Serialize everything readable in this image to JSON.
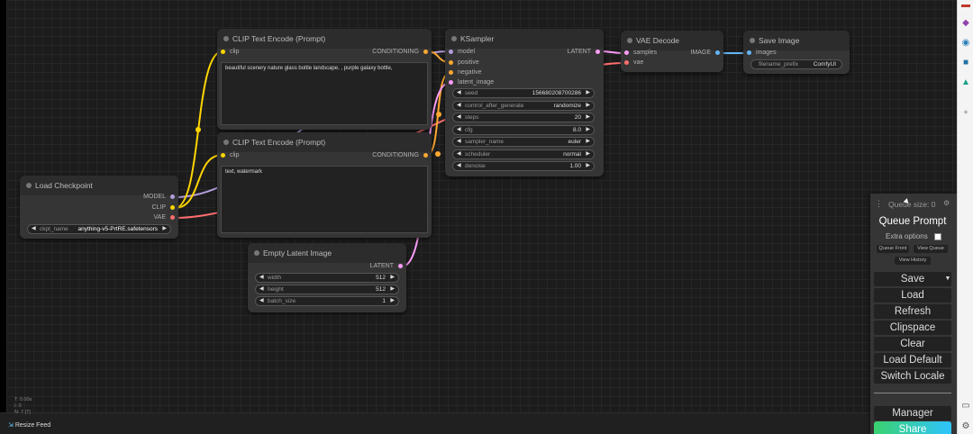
{
  "colors": {
    "clip": "#ffd500",
    "conditioning": "#ffa931",
    "model": "#b39ddb",
    "vae": "#ff6e6e",
    "latent": "#ff9cf9",
    "image": "#64b5f6",
    "share_gradient_start": "#3bd16f",
    "share_gradient_end": "#2ec4ff"
  },
  "nodes": {
    "clip_pos": {
      "title": "CLIP Text Encode (Prompt)",
      "input_clip": "clip",
      "output": "CONDITIONING",
      "text": "beautiful scenery nature glass bottle landscape, , purple galaxy bottle,"
    },
    "clip_neg": {
      "title": "CLIP Text Encode (Prompt)",
      "input_clip": "clip",
      "output": "CONDITIONING",
      "text": "text, watermark"
    },
    "ksampler": {
      "title": "KSampler",
      "inputs": [
        "model",
        "positive",
        "negative",
        "latent_image"
      ],
      "output": "LATENT",
      "widgets": [
        {
          "label": "seed",
          "value": "156680208700286"
        },
        {
          "label": "control_after_generate",
          "value": "randomize"
        },
        {
          "label": "steps",
          "value": "20"
        },
        {
          "label": "cfg",
          "value": "8.0"
        },
        {
          "label": "sampler_name",
          "value": "euler"
        },
        {
          "label": "scheduler",
          "value": "normal"
        },
        {
          "label": "denoise",
          "value": "1.00"
        }
      ]
    },
    "vae_decode": {
      "title": "VAE Decode",
      "inputs": [
        "samples",
        "vae"
      ],
      "output": "IMAGE"
    },
    "save_image": {
      "title": "Save Image",
      "input": "images",
      "widget_label": "filename_prefix",
      "widget_value": "ComfyUI"
    },
    "load_checkpoint": {
      "title": "Load Checkpoint",
      "outputs": [
        "MODEL",
        "CLIP",
        "VAE"
      ],
      "widget_label": "ckpt_name",
      "widget_value": "anything-v5-PrtRE.safetensors"
    },
    "empty_latent": {
      "title": "Empty Latent Image",
      "output": "LATENT",
      "widgets": [
        {
          "label": "width",
          "value": "512"
        },
        {
          "label": "height",
          "value": "512"
        },
        {
          "label": "batch_size",
          "value": "1"
        }
      ]
    }
  },
  "panel": {
    "queue_size": "Queue size: 0",
    "queue_prompt": "Queue Prompt",
    "extra_options": "Extra options",
    "queue_front": "Queue Front",
    "view_queue": "View Queue",
    "view_history": "View History",
    "save": "Save",
    "load": "Load",
    "refresh": "Refresh",
    "clipspace": "Clipspace",
    "clear": "Clear",
    "load_default": "Load Default",
    "switch_locale": "Switch Locale",
    "manager": "Manager",
    "share": "Share"
  },
  "footer": {
    "resize_feed": "Resize Feed",
    "coord_lines": [
      "T: 0.00s",
      "I: 0",
      "N: 7 [7]"
    ]
  }
}
